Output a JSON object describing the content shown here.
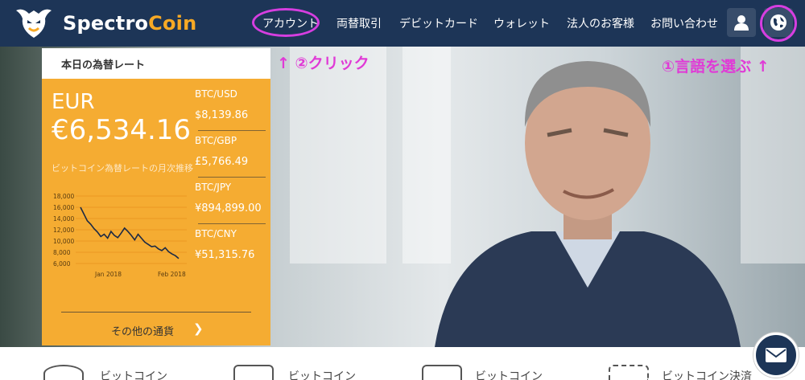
{
  "brand": {
    "name_part1": "Spectro",
    "name_part2": "Coin"
  },
  "nav": {
    "items": [
      {
        "label": "アカウント"
      },
      {
        "label": "両替取引"
      },
      {
        "label": "デビットカード"
      },
      {
        "label": "ウォレット"
      },
      {
        "label": "法人のお客様"
      },
      {
        "label": "お問い合わせ"
      }
    ]
  },
  "annotations": {
    "click_hint": "↑ ②クリック",
    "language_hint": "①言語を選ぶ ↑"
  },
  "rates": {
    "title": "本日の為替レート",
    "currency": "EUR",
    "price": "€6,534.16",
    "chart_label": "ビットコイン為替レートの月次推移",
    "pairs": [
      {
        "name": "BTC/USD",
        "value": "$8,139.86"
      },
      {
        "name": "BTC/GBP",
        "value": "£5,766.49"
      },
      {
        "name": "BTC/JPY",
        "value": "¥894,899.00"
      },
      {
        "name": "BTC/CNY",
        "value": "¥51,315.76"
      }
    ],
    "more_label": "その他の通貨",
    "more_icon": "chevron-right-icon"
  },
  "chart_data": {
    "type": "line",
    "title": "ビットコイン為替レートの月次推移",
    "x_ticks": [
      "Jan 2018",
      "Feb 2018"
    ],
    "y_ticks": [
      "18,000",
      "16,000",
      "14,000",
      "12,000",
      "10,000",
      "8,000",
      "6,000"
    ],
    "ylim": [
      6000,
      18000
    ],
    "series": [
      {
        "values": [
          16000,
          14800,
          13600,
          13000,
          12200,
          11600,
          10800,
          11200,
          10500,
          11700,
          11000,
          10600,
          11400,
          12300,
          11700,
          11000,
          10200,
          11200,
          10500,
          9800,
          9400,
          9000,
          9100,
          8600,
          8300,
          8800,
          8100,
          7700,
          7400,
          6900
        ]
      }
    ]
  },
  "features": [
    {
      "label": "ビットコイン"
    },
    {
      "label": "ビットコイン"
    },
    {
      "label": "ビットコイン"
    },
    {
      "label": "ビットコイン決済"
    }
  ],
  "colors": {
    "nav_bg": "#1d3557",
    "accent": "#f7a925",
    "highlight": "#d63ee0",
    "card": "#f5ac32"
  }
}
